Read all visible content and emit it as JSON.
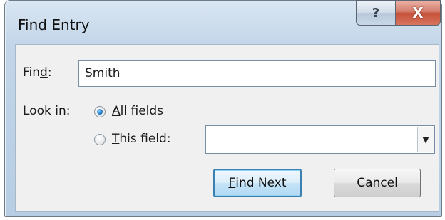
{
  "window": {
    "title": "Find Entry",
    "help_glyph": "?",
    "close_glyph": "X"
  },
  "find": {
    "label_prefix": "Fin",
    "label_accel": "d",
    "label_suffix": ":",
    "value": "Smith"
  },
  "look_in": {
    "label": "Look in:",
    "all_fields": {
      "accel": "A",
      "rest": "ll fields",
      "checked": true
    },
    "this_field": {
      "accel": "T",
      "rest": "his field:",
      "checked": false,
      "value": ""
    },
    "dropdown_arrow": "▼"
  },
  "buttons": {
    "find_next": {
      "accel": "F",
      "rest": "ind Next"
    },
    "cancel": "Cancel"
  },
  "colors": {
    "title_bar": "#c3d6e9",
    "close_button": "#c6523a",
    "default_button_border": "#3c7fb1",
    "radio_dot": "#1f78c4"
  }
}
